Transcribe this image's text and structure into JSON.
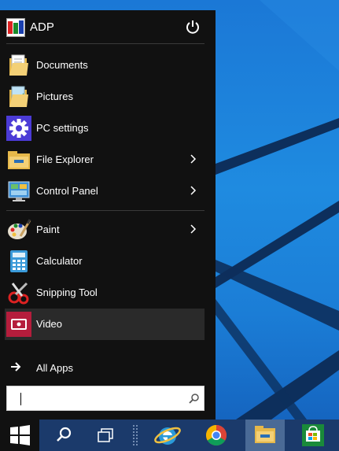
{
  "user": {
    "name": "ADP"
  },
  "menu": {
    "items": [
      {
        "label": "Documents",
        "icon": "documents-folder-icon",
        "has_arrow": false
      },
      {
        "label": "Pictures",
        "icon": "pictures-folder-icon",
        "has_arrow": false
      },
      {
        "label": "PC settings",
        "icon": "gear-icon",
        "has_arrow": false
      },
      {
        "label": "File Explorer",
        "icon": "file-explorer-icon",
        "has_arrow": true
      },
      {
        "label": "Control Panel",
        "icon": "control-panel-icon",
        "has_arrow": true
      },
      {
        "label": "Paint",
        "icon": "paint-icon",
        "has_arrow": true
      },
      {
        "label": "Calculator",
        "icon": "calculator-icon",
        "has_arrow": false
      },
      {
        "label": "Snipping Tool",
        "icon": "snipping-tool-icon",
        "has_arrow": false
      },
      {
        "label": "Video",
        "icon": "video-icon",
        "has_arrow": false,
        "active": true
      }
    ],
    "all_apps_label": "All Apps"
  },
  "search": {
    "value": "",
    "placeholder": ""
  },
  "taskbar": {
    "buttons": [
      {
        "name": "search",
        "icon": "search-icon"
      },
      {
        "name": "task-view",
        "icon": "task-view-icon"
      },
      {
        "name": "internet-explorer",
        "icon": "internet-explorer-icon"
      },
      {
        "name": "chrome",
        "icon": "chrome-icon"
      },
      {
        "name": "file-explorer",
        "icon": "file-explorer-icon",
        "active": true
      },
      {
        "name": "store",
        "icon": "store-icon"
      }
    ]
  },
  "colors": {
    "menu_bg": "#111111",
    "accent": "#1b78d6",
    "taskbar": "#1b3a6b"
  }
}
